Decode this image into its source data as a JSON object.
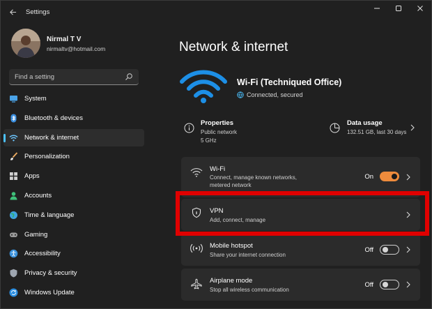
{
  "window": {
    "title": "Settings"
  },
  "profile": {
    "name": "Nirmal T V",
    "email": "nirmaltv@hotmail.com"
  },
  "search": {
    "placeholder": "Find a setting"
  },
  "nav": [
    {
      "label": "System",
      "icon": "system-icon",
      "active": false
    },
    {
      "label": "Bluetooth & devices",
      "icon": "bluetooth-icon",
      "active": false
    },
    {
      "label": "Network & internet",
      "icon": "network-icon",
      "active": true
    },
    {
      "label": "Personalization",
      "icon": "brush-icon",
      "active": false
    },
    {
      "label": "Apps",
      "icon": "apps-icon",
      "active": false
    },
    {
      "label": "Accounts",
      "icon": "person-icon",
      "active": false
    },
    {
      "label": "Time & language",
      "icon": "globe-icon",
      "active": false
    },
    {
      "label": "Gaming",
      "icon": "gamepad-icon",
      "active": false
    },
    {
      "label": "Accessibility",
      "icon": "accessibility-icon",
      "active": false
    },
    {
      "label": "Privacy & security",
      "icon": "shield-icon",
      "active": false
    },
    {
      "label": "Windows Update",
      "icon": "update-icon",
      "active": false
    }
  ],
  "main": {
    "title": "Network & internet",
    "wifi": {
      "name": "Wi-Fi (Techniqued Office)",
      "status": "Connected, secured"
    },
    "properties": {
      "title": "Properties",
      "line1": "Public network",
      "line2": "5 GHz"
    },
    "data_usage": {
      "title": "Data usage",
      "detail": "132.51 GB, last 30 days"
    },
    "cards": [
      {
        "title": "Wi-Fi",
        "sub1": "Connect, manage known networks,",
        "sub2": "metered network",
        "toggle_label": "On",
        "toggle_on": true
      },
      {
        "title": "VPN",
        "sub1": "Add, connect, manage"
      },
      {
        "title": "Mobile hotspot",
        "sub1": "Share your internet connection",
        "toggle_label": "Off",
        "toggle_on": false
      },
      {
        "title": "Airplane mode",
        "sub1": "Stop all wireless communication",
        "toggle_label": "Off",
        "toggle_on": false
      }
    ]
  },
  "colors": {
    "accent": "#4cc2ff",
    "toggle_on": "#ee8b3c",
    "highlight": "#e00000",
    "background": "#202020",
    "card": "#2b2b2b"
  }
}
